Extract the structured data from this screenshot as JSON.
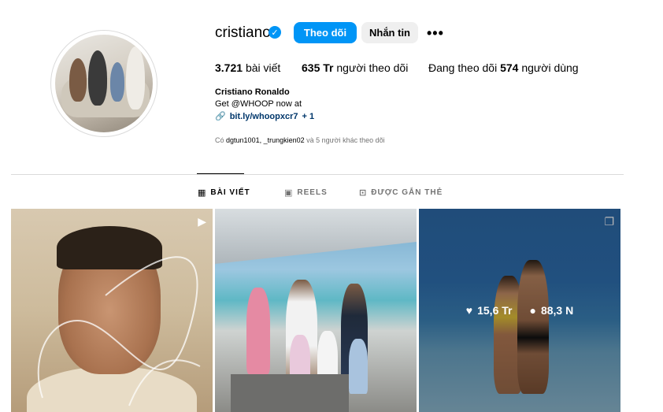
{
  "profile": {
    "username": "cristiano",
    "follow_label": "Theo dõi",
    "message_label": "Nhắn tin",
    "more_label": "•••",
    "stats": {
      "posts_count": "3.721",
      "posts_label": "bài viết",
      "followers_count": "635 Tr",
      "followers_label": "người theo dõi",
      "following_prefix": "Đang theo dõi",
      "following_count": "574",
      "following_label": "người dùng"
    },
    "full_name": "Cristiano Ronaldo",
    "bio": "Get @WHOOP now at",
    "link": "bit.ly/whoopxcr7",
    "link_more": "+ 1",
    "followed_by_prefix": "Có",
    "followed_by_users": "dgtun1001, _trungkien02",
    "followed_by_suffix": "và 5 người khác theo dõi"
  },
  "tabs": [
    {
      "label": "BÀI VIẾT",
      "icon": "grid-icon",
      "active": true
    },
    {
      "label": "REELS",
      "icon": "reels-icon",
      "active": false
    },
    {
      "label": "ĐƯỢC GẮN THẺ",
      "icon": "tagged-icon",
      "active": false
    }
  ],
  "posts": [
    {
      "type_icon": "reels-icon"
    },
    {
      "type_icon": ""
    },
    {
      "type_icon": "carousel-icon",
      "likes": "15,6 Tr",
      "comments": "88,3 N"
    }
  ],
  "colors": {
    "accent": "#0095f6",
    "secondary_button": "#efefef",
    "link": "#00376b",
    "muted_text": "#737373",
    "divider": "#dbdbdb"
  }
}
